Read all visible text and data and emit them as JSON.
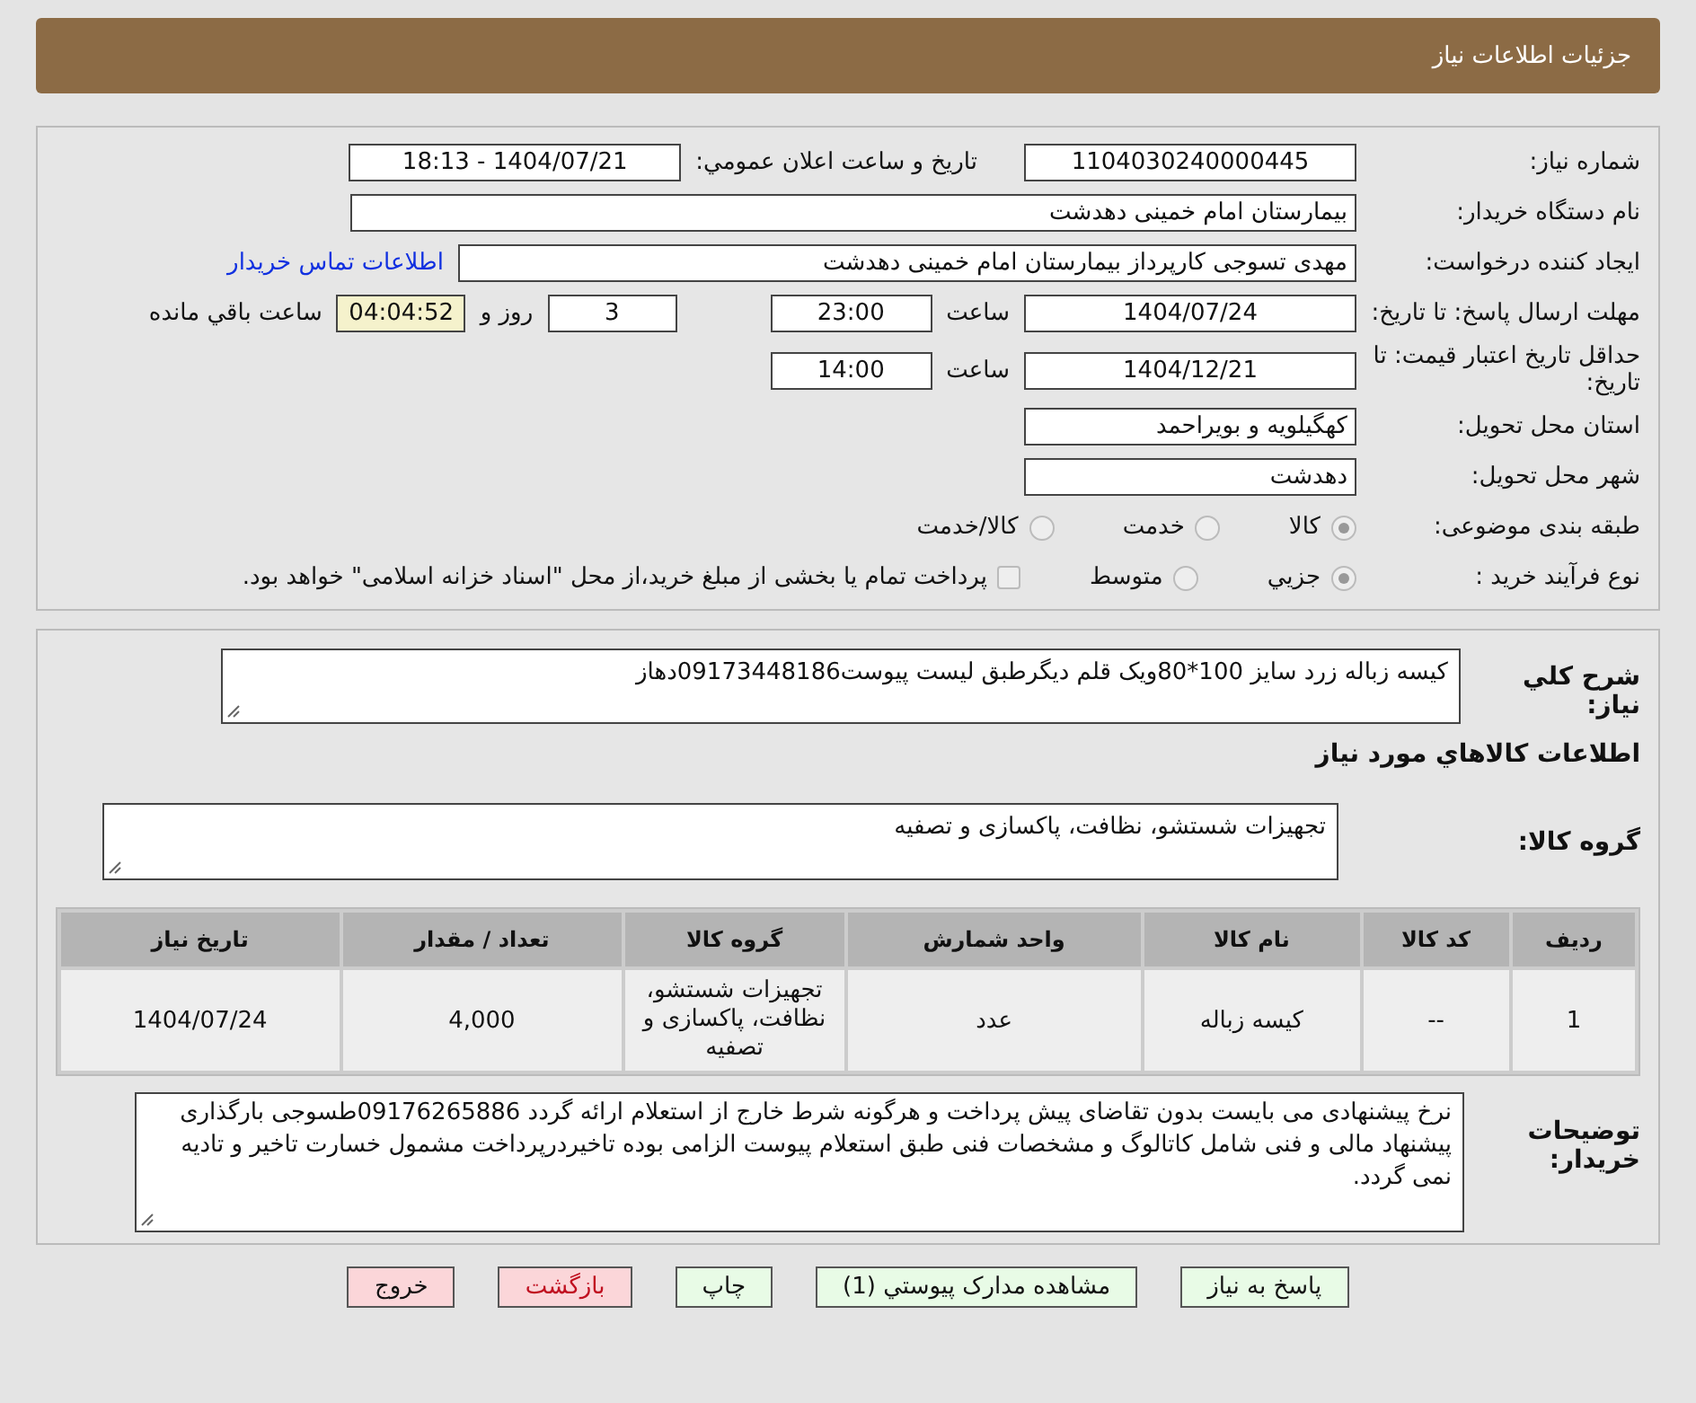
{
  "header": {
    "title": "جزئیات اطلاعات نیاز"
  },
  "details": {
    "need_number": {
      "label": "شماره نیاز:",
      "value": "1104030240000445"
    },
    "announce": {
      "label": "تاریخ و ساعت اعلان عمومي:",
      "value": "1404/07/21 - 18:13"
    },
    "buyer": {
      "label": "نام دستگاه خریدار:",
      "value": "بیمارستان امام خمینی دهدشت"
    },
    "creator": {
      "label": "ایجاد کننده درخواست:",
      "value": "مهدی تسوجی کارپرداز بیمارستان امام خمینی دهدشت",
      "link": "اطلاعات تماس خریدار"
    },
    "deadline": {
      "label": "مهلت ارسال پاسخ: تا تاریخ:",
      "date": "1404/07/24",
      "time_label": "ساعت",
      "time": "23:00",
      "days": "3",
      "days_label": "روز و",
      "remaining": "04:04:52",
      "remaining_label": "ساعت باقي مانده"
    },
    "validity": {
      "label": "حداقل تاریخ اعتبار قیمت: تا تاریخ:",
      "date": "1404/12/21",
      "time_label": "ساعت",
      "time": "14:00"
    },
    "province": {
      "label": "استان محل تحویل:",
      "value": "کهگیلویه و بویراحمد"
    },
    "city": {
      "label": "شهر محل تحویل:",
      "value": "دهدشت"
    },
    "category": {
      "label": "طبقه بندی موضوعی:",
      "options": [
        {
          "label": "كالا",
          "selected": true
        },
        {
          "label": "خدمت",
          "selected": false
        },
        {
          "label": "كالا/خدمت",
          "selected": false
        }
      ]
    },
    "process": {
      "label": "نوع فرآیند خرید :",
      "options": [
        {
          "label": "جزيي",
          "selected": true
        },
        {
          "label": "متوسط",
          "selected": false
        }
      ],
      "treasury": {
        "label": "پرداخت تمام یا بخشی از مبلغ خرید،از محل \"اسناد خزانه اسلامی\" خواهد بود.",
        "checked": false
      }
    }
  },
  "summary": {
    "label": "شرح كلي نياز:",
    "value": "كيسه زباله زرد سايز 100*80ویک قلم دیگرطبق لیست پیوست09173448186دهاز"
  },
  "goods_heading": "اطلاعات كالاهاي مورد نياز",
  "goods_group": {
    "label": "گروه کالا:",
    "value": "تجهیزات شستشو، نظافت، پاکسازی و تصفیه"
  },
  "table": {
    "columns": [
      "ردیف",
      "کد کالا",
      "نام کالا",
      "واحد شمارش",
      "گروه کالا",
      "تعداد / مقدار",
      "تاریخ نیاز"
    ],
    "rows": [
      [
        "1",
        "--",
        "کیسه زباله",
        "عدد",
        "تجهیزات شستشو، نظافت، پاکسازی و تصفیه",
        "4,000",
        "1404/07/24"
      ]
    ]
  },
  "notes": {
    "label": "توضیحات خریدار:",
    "value": "نرخ پیشنهادی می بایست بدون تقاضای پیش پرداخت و هرگونه شرط خارج از استعلام ارائه گردد 09176265886طسوجی بارگذاری پیشنهاد مالی و فنی شامل کاتالوگ و مشخصات فنی طبق استعلام پیوست الزامی بوده تاخیردرپرداخت مشمول خسارت تاخیر و تادیه نمی گردد."
  },
  "buttons": [
    {
      "label": "پاسخ به نیاز",
      "kind": "action"
    },
    {
      "label": "مشاهده مدارک پیوستي (1)",
      "kind": "action"
    },
    {
      "label": "چاپ",
      "kind": "action"
    },
    {
      "label": "بازگشت",
      "kind": "danger"
    },
    {
      "label": "خروج",
      "kind": "exit"
    }
  ]
}
